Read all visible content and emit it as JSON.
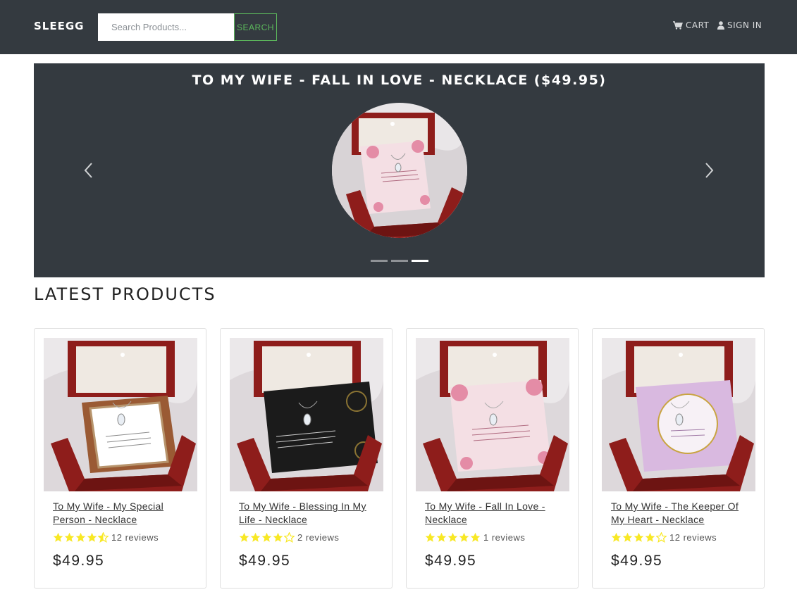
{
  "navbar": {
    "brand": "SLEEGG",
    "search_placeholder": "Search Products...",
    "search_button": "SEARCH",
    "cart_label": "CART",
    "signin_label": "SIGN IN"
  },
  "carousel": {
    "title": "TO MY WIFE - FALL IN LOVE - NECKLACE ($49.95)",
    "active_index": 2,
    "slide_count": 3
  },
  "section": {
    "title": "LATEST PRODUCTS"
  },
  "products": [
    {
      "name": "To My Wife - My Special Person - Necklace",
      "rating": 4.5,
      "reviews": "12 reviews",
      "price": "$49.95",
      "card_theme": "beige-frame"
    },
    {
      "name": "To My Wife - Blessing In My Life - Necklace",
      "rating": 4,
      "reviews": "2 reviews",
      "price": "$49.95",
      "card_theme": "black-gold"
    },
    {
      "name": "To My Wife - Fall In Love - Necklace",
      "rating": 5,
      "reviews": "1 reviews",
      "price": "$49.95",
      "card_theme": "pink-roses"
    },
    {
      "name": "To My Wife - The Keeper Of My Heart - Necklace",
      "rating": 4,
      "reviews": "12 reviews",
      "price": "$49.95",
      "card_theme": "lavender"
    }
  ],
  "colors": {
    "navbar_bg": "#343a40",
    "accent_green": "#5cb85c",
    "star_yellow": "#f8e825"
  }
}
